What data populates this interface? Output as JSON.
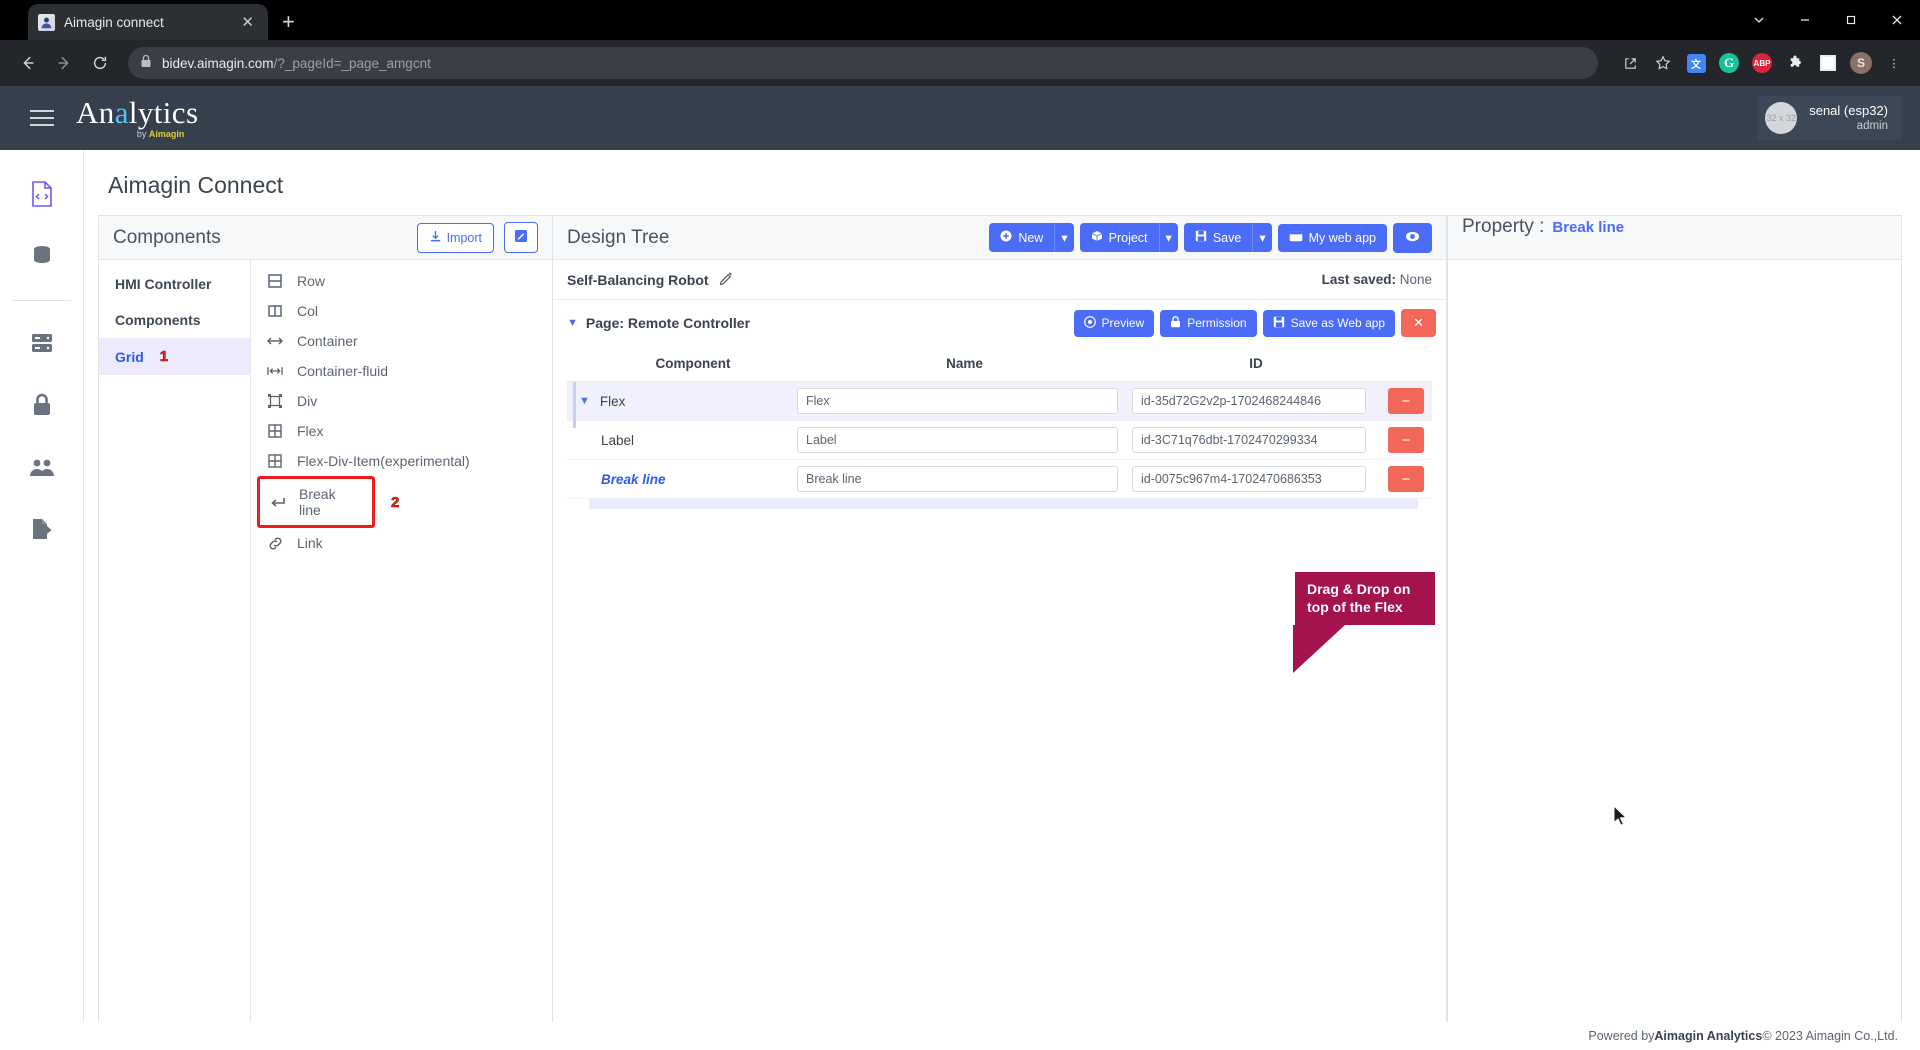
{
  "browser": {
    "tab_title": "Aimagin connect",
    "tab_close": "✕",
    "new_tab": "+",
    "url_domain": "bidev.aimagin.com",
    "url_path": "/?_pageId=_page_amgcnt",
    "icons": {
      "back": "back-arrow",
      "forward": "forward-arrow",
      "reload": "reload",
      "lock": "lock",
      "share": "share",
      "star": "star",
      "translate": "G文",
      "grammarly": "G",
      "abp": "ABP",
      "extensions": "puzzle",
      "square": "square",
      "profile": "S",
      "menu": "⋮"
    },
    "window": {
      "chevron": "chevron-down",
      "minimize": "−",
      "maximize": "❐",
      "close": "✕"
    }
  },
  "header": {
    "brand_pre": "An",
    "brand_hl": "a",
    "brand_post": "lytics",
    "brand_sub_pre": "by ",
    "brand_sub_brand": "Aimagin",
    "user_name": "senal (esp32)",
    "user_role": "admin",
    "avatar_text": "32 x 32"
  },
  "rail": {
    "items": [
      {
        "name": "code-file-icon",
        "active": true
      },
      {
        "name": "database-icon",
        "active": false
      },
      {
        "name": "server-icon",
        "active": false
      },
      {
        "name": "lock-icon",
        "active": false
      },
      {
        "name": "users-icon",
        "active": false
      },
      {
        "name": "export-icon",
        "active": false
      }
    ]
  },
  "page": {
    "title": "Aimagin Connect"
  },
  "components_panel": {
    "title": "Components",
    "import_label": "Import",
    "edit_icon": "pencil-square",
    "categories": [
      {
        "label": "HMI Controller",
        "active": false,
        "badge": ""
      },
      {
        "label": "Components",
        "active": false,
        "badge": ""
      },
      {
        "label": "Grid",
        "active": true,
        "badge": "1"
      }
    ],
    "items": [
      {
        "label": "Row",
        "icon": "row-icon",
        "boxed": false,
        "badge": ""
      },
      {
        "label": "Col",
        "icon": "col-icon",
        "boxed": false,
        "badge": ""
      },
      {
        "label": "Container",
        "icon": "arrows-h-icon",
        "boxed": false,
        "badge": ""
      },
      {
        "label": "Container-fluid",
        "icon": "arrows-h-bounded-icon",
        "boxed": false,
        "badge": ""
      },
      {
        "label": "Div",
        "icon": "div-icon",
        "boxed": false,
        "badge": ""
      },
      {
        "label": "Flex",
        "icon": "grid-icon",
        "boxed": false,
        "badge": ""
      },
      {
        "label": "Flex-Div-Item(experimental)",
        "icon": "grid-icon",
        "boxed": false,
        "badge": ""
      },
      {
        "label": "Break line",
        "icon": "enter-arrow-icon",
        "boxed": true,
        "badge": "2"
      },
      {
        "label": "Link",
        "icon": "link-icon",
        "boxed": false,
        "badge": ""
      }
    ]
  },
  "design_tree": {
    "title": "Design Tree",
    "toolbar": {
      "new_label": "New",
      "project_label": "Project",
      "save_label": "Save",
      "my_web_app_label": "My web app",
      "eye_icon": "eye-icon",
      "caret": "▾"
    },
    "project_name": "Self-Balancing Robot",
    "edit_icon": "pencil-icon",
    "last_saved_label": "Last saved:",
    "last_saved_value": "None",
    "page_label": "Page: Remote Controller",
    "page_actions": {
      "preview": "Preview",
      "permission": "Permission",
      "save_as_web_app": "Save as Web app",
      "close": "✕"
    },
    "columns": [
      "Component",
      "Name",
      "ID"
    ],
    "rows": [
      {
        "component": "Flex",
        "name": "Flex",
        "id": "id-35d72G2v2p-1702468244846",
        "indent": 0,
        "expandable": true,
        "selected": true,
        "style": "normal"
      },
      {
        "component": "Label",
        "name": "Label",
        "id": "id-3C71q76dbt-1702470299334",
        "indent": 1,
        "expandable": false,
        "selected": false,
        "style": "normal"
      },
      {
        "component": "Break line",
        "name": "Break line",
        "id": "id-0075c967m4-1702470686353",
        "indent": 1,
        "expandable": false,
        "selected": false,
        "style": "highlight"
      }
    ],
    "remove_icon": "−"
  },
  "tooltip": {
    "line1": "Drag & Drop on",
    "line2": "top of the Flex"
  },
  "property_panel": {
    "label": "Property :",
    "value": "Break line"
  },
  "footer": {
    "pre": "Powered by ",
    "brand": "Aimagin Analytics",
    "post": " © 2023 Aimagin Co.,Ltd."
  }
}
